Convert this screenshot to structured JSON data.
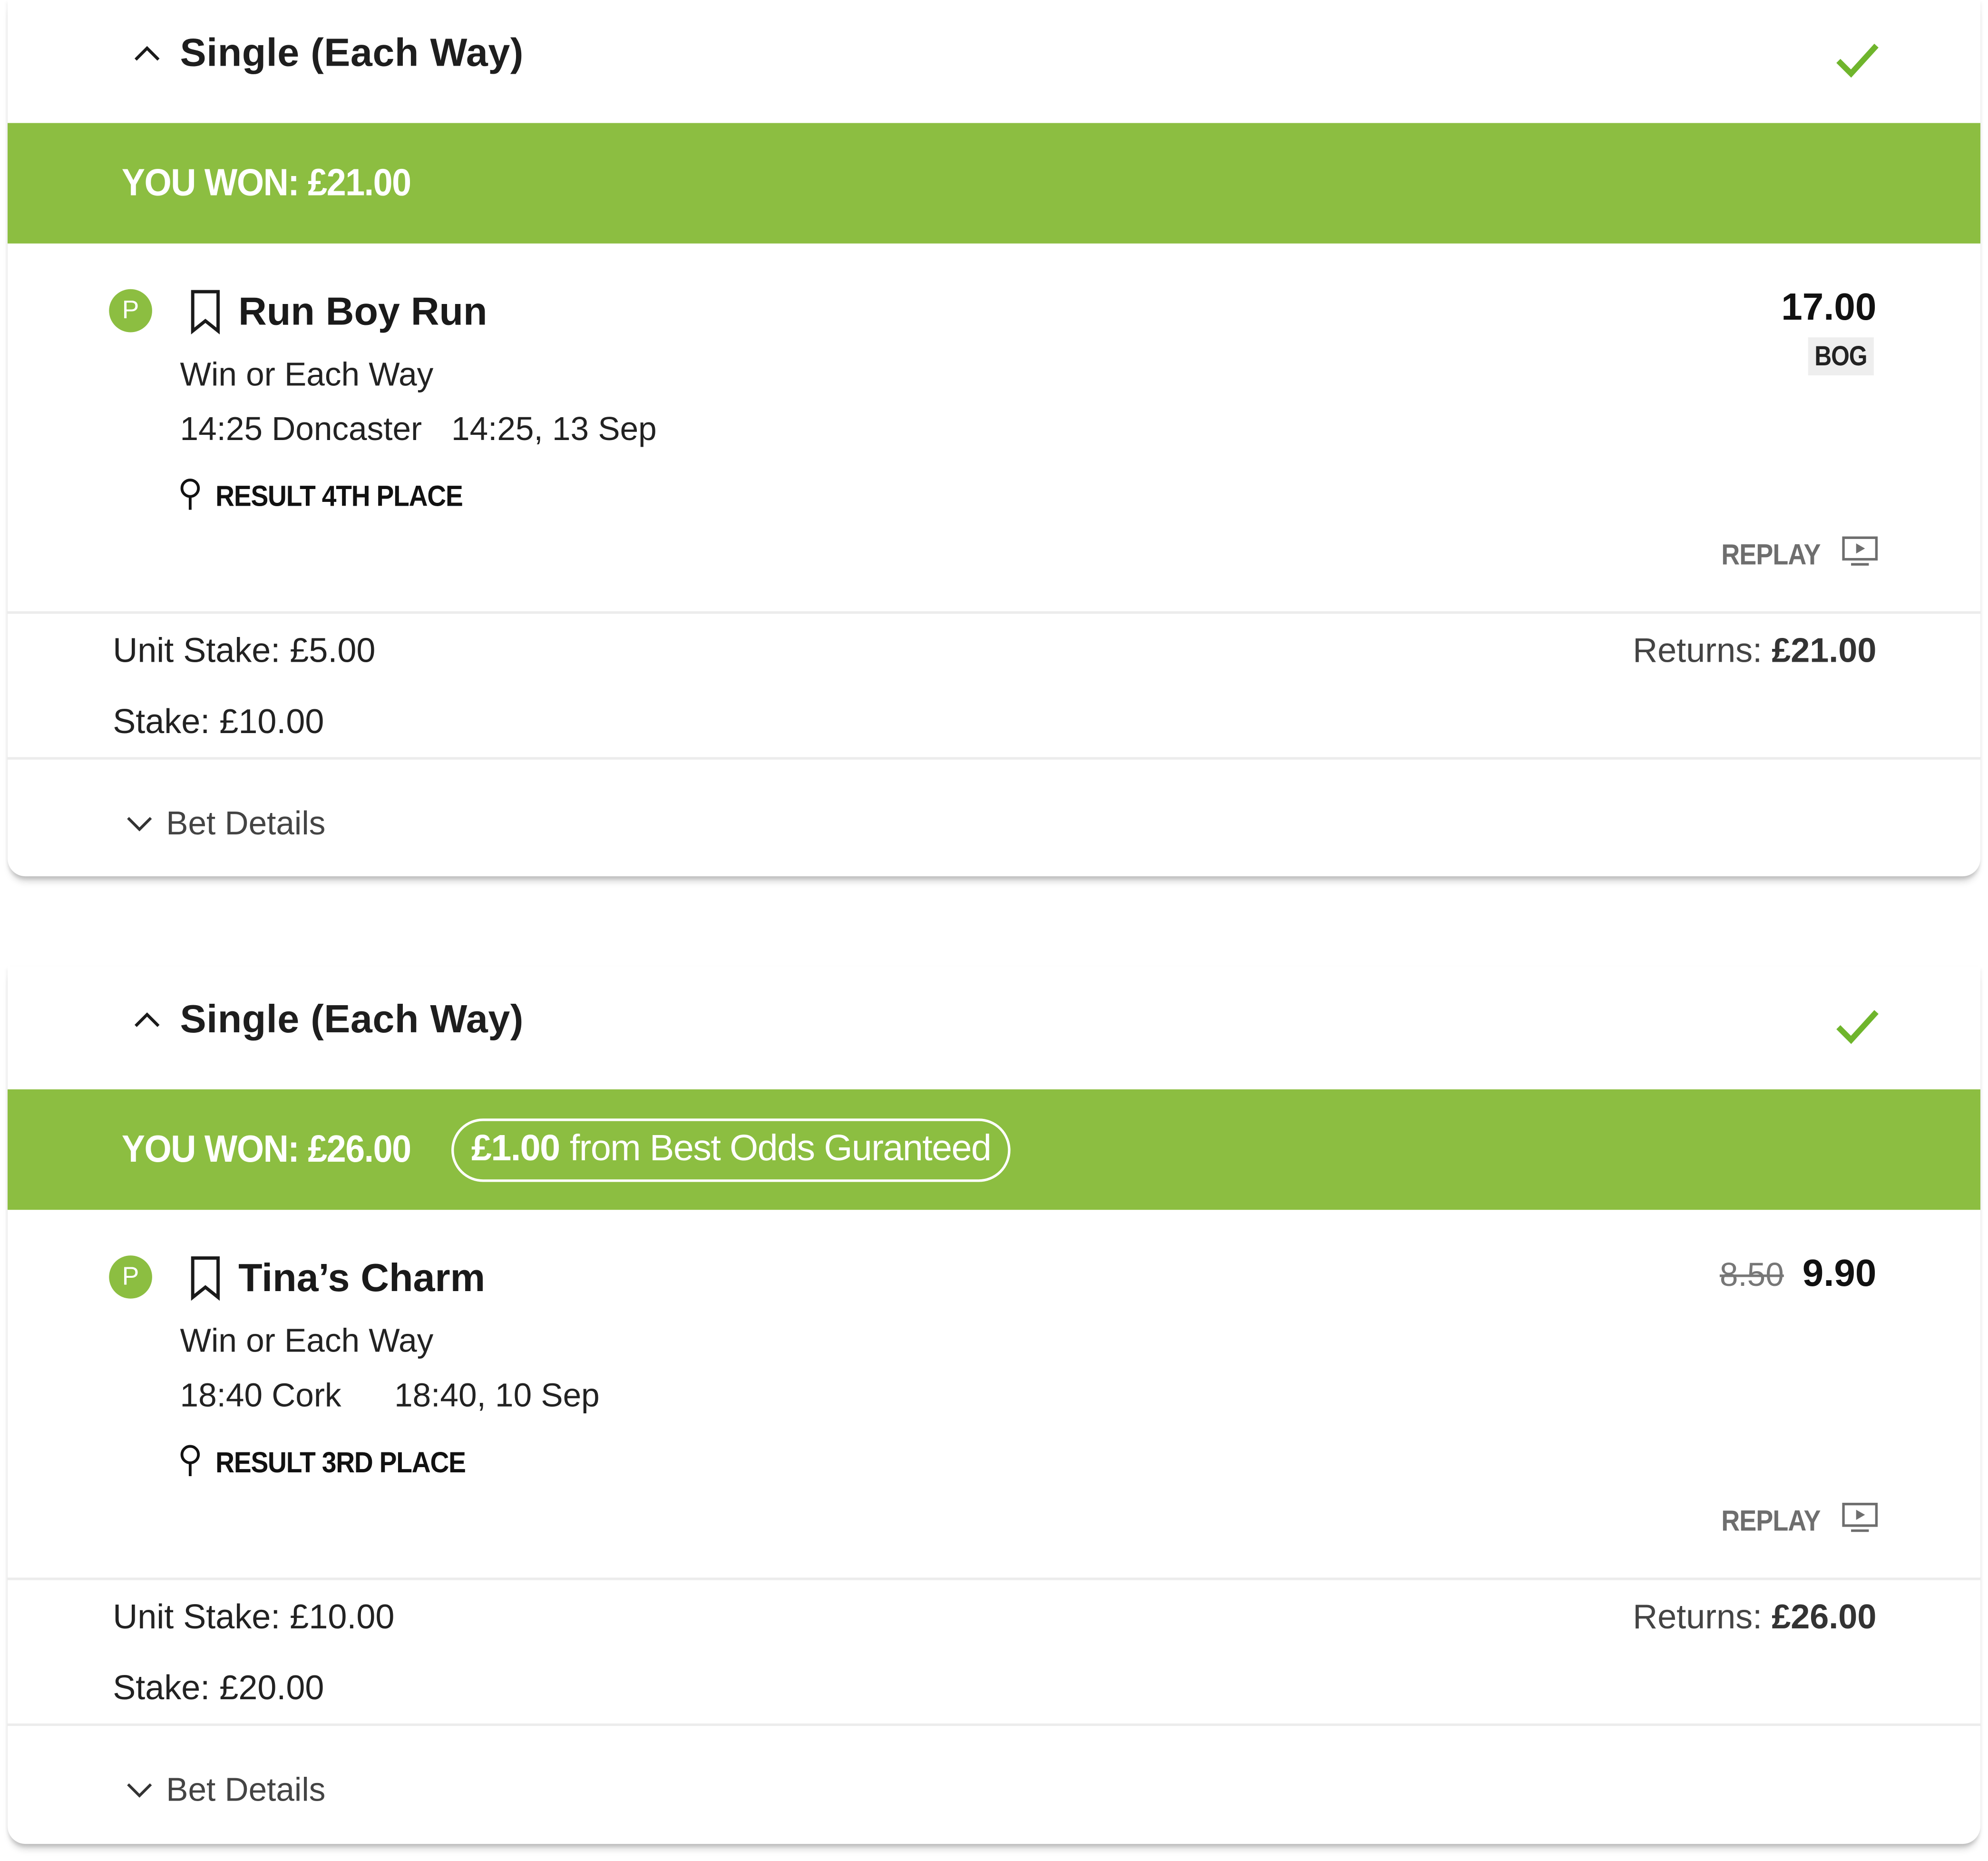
{
  "bets": [
    {
      "title": "Single (Each Way)",
      "won": "YOU WON: £21.00",
      "selection": {
        "badge": "P",
        "runner": "Run Boy Run",
        "market": "Win or Each Way",
        "event": "14:25 Doncaster",
        "event_time": "14:25, 13 Sep",
        "result": "RESULT 4TH PLACE",
        "odds": "17.00",
        "odds_tag": "BOG",
        "replay": "REPLAY"
      },
      "unit_stake": "Unit Stake: £5.00",
      "stake": "Stake: £10.00",
      "returns_label": "Returns:",
      "returns_value": "£21.00",
      "details": "Bet Details"
    },
    {
      "title": "Single (Each Way)",
      "won": "YOU WON: £26.00",
      "bog_amount": "£1.00",
      "bog_text": "from Best Odds Guranteed",
      "selection": {
        "badge": "P",
        "runner": "Tina’s Charm",
        "market": "Win or Each Way",
        "event": "18:40 Cork",
        "event_time": "18:40, 10 Sep",
        "result": "RESULT 3RD PLACE",
        "old_odds": "8.50",
        "odds": "9.90",
        "replay": "REPLAY"
      },
      "unit_stake": "Unit Stake: £10.00",
      "stake": "Stake: £20.00",
      "returns_label": "Returns:",
      "returns_value": "£26.00",
      "details": "Bet Details"
    }
  ],
  "colors": {
    "accent_green": "#8cbe41",
    "check_green": "#6fb52c"
  },
  "icons": [
    "chevron-up-icon",
    "check-icon",
    "bookmark-icon",
    "location-pin-icon",
    "replay-tv-icon",
    "chevron-down-icon"
  ]
}
